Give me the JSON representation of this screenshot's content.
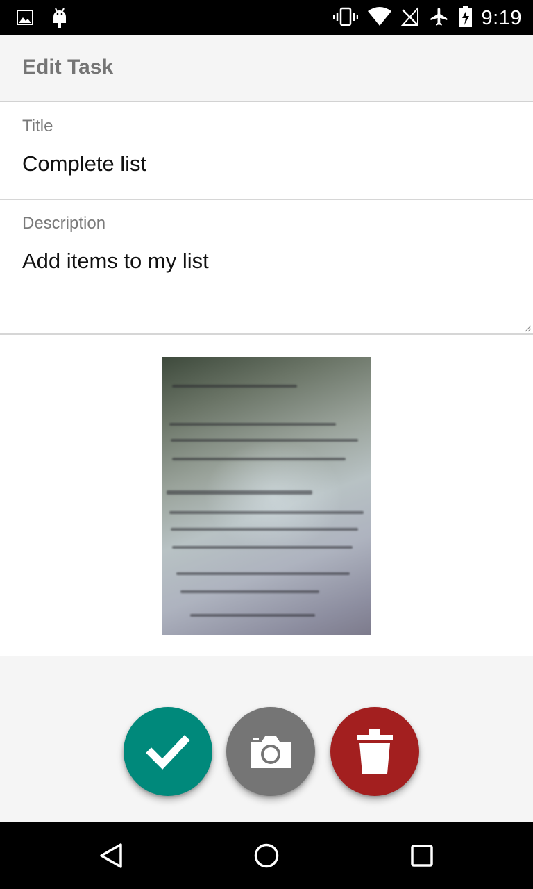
{
  "status_bar": {
    "time": "9:19",
    "left_icons": [
      "image-notification-icon",
      "android-notification-icon"
    ],
    "right_icons": [
      "vibrate-icon",
      "wifi-icon",
      "no-signal-icon",
      "airplane-mode-icon",
      "battery-charging-icon"
    ]
  },
  "app_bar": {
    "title": "Edit Task"
  },
  "form": {
    "title_label": "Title",
    "title_value": "Complete list",
    "description_label": "Description",
    "description_value": "Add items to my list"
  },
  "photo": {
    "alt": "task-photo"
  },
  "actions": {
    "save_icon": "check-icon",
    "camera_icon": "camera-icon",
    "delete_icon": "trash-icon",
    "colors": {
      "save": "#00897b",
      "camera": "#757575",
      "delete": "#a31f1f"
    }
  },
  "nav_bar": {
    "icons": [
      "back-icon",
      "home-icon",
      "recents-icon"
    ]
  }
}
